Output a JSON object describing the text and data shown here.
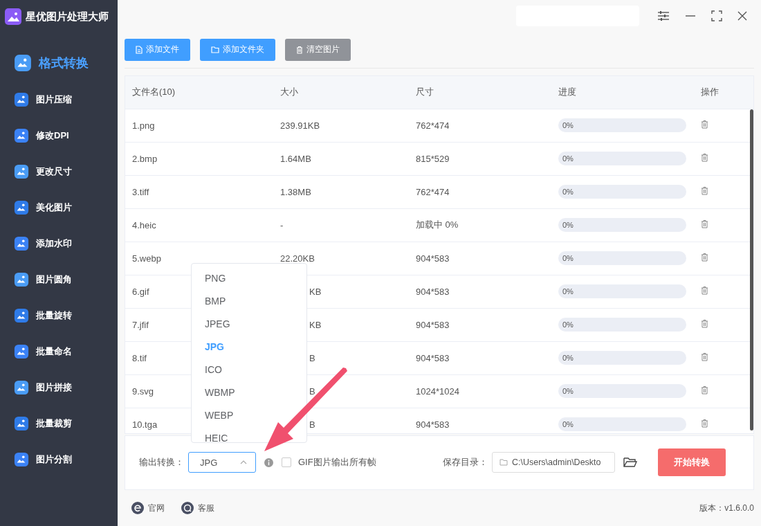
{
  "app": {
    "title": "星优图片处理大师"
  },
  "sidebar": {
    "items": [
      {
        "label": "格式转换",
        "selected": true
      },
      {
        "label": "图片压缩",
        "selected": false
      },
      {
        "label": "修改DPI",
        "selected": false
      },
      {
        "label": "更改尺寸",
        "selected": false
      },
      {
        "label": "美化图片",
        "selected": false
      },
      {
        "label": "添加水印",
        "selected": false
      },
      {
        "label": "图片圆角",
        "selected": false
      },
      {
        "label": "批量旋转",
        "selected": false
      },
      {
        "label": "批量命名",
        "selected": false
      },
      {
        "label": "图片拼接",
        "selected": false
      },
      {
        "label": "批量裁剪",
        "selected": false
      },
      {
        "label": "图片分割",
        "selected": false
      }
    ]
  },
  "toolbar": [
    {
      "label": "添加文件",
      "kind": "file"
    },
    {
      "label": "添加文件夹",
      "kind": "folder"
    },
    {
      "label": "清空图片",
      "kind": "clear"
    }
  ],
  "table": {
    "columns": [
      "文件名(10)",
      "大小",
      "尺寸",
      "进度",
      "操作"
    ],
    "rows": [
      {
        "name": "1.png",
        "size": "239.91KB",
        "dims": "762*474",
        "progress": "0%",
        "level": 0,
        "clipped": false
      },
      {
        "name": "2.bmp",
        "size": "1.64MB",
        "dims": "815*529",
        "progress": "0%",
        "level": 0,
        "clipped": false
      },
      {
        "name": "3.tiff",
        "size": "1.38MB",
        "dims": "762*474",
        "progress": "0%",
        "level": 0,
        "clipped": false
      },
      {
        "name": "4.heic",
        "size": "-",
        "dims": "加载中 0%",
        "progress": "0%",
        "level": 0,
        "clipped": false
      },
      {
        "name": "5.webp",
        "size": "22.20KB",
        "dims": "904*583",
        "progress": "0%",
        "level": 0,
        "clipped": false
      },
      {
        "name": "6.gif",
        "size": "KB",
        "dims": "904*583",
        "progress": "0%",
        "level": 0,
        "clipped": true
      },
      {
        "name": "7.jfif",
        "size": "KB",
        "dims": "904*583",
        "progress": "0%",
        "level": 0,
        "clipped": true
      },
      {
        "name": "8.tif",
        "size": "B",
        "dims": "904*583",
        "progress": "0%",
        "level": 0,
        "clipped": true
      },
      {
        "name": "9.svg",
        "size": "B",
        "dims": "1024*1024",
        "progress": "0%",
        "level": 0,
        "clipped": true
      },
      {
        "name": "10.tga",
        "size": "B",
        "dims": "904*583",
        "progress": "0%",
        "level": 0,
        "clipped": true
      }
    ]
  },
  "dropdown": {
    "options": [
      {
        "label": "PNG",
        "selected": false
      },
      {
        "label": "BMP",
        "selected": false
      },
      {
        "label": "JPEG",
        "selected": false
      },
      {
        "label": "JPG",
        "selected": true
      },
      {
        "label": "ICO",
        "selected": false
      },
      {
        "label": "WBMP",
        "selected": false
      },
      {
        "label": "WEBP",
        "selected": false
      },
      {
        "label": "HEIC",
        "selected": false
      }
    ]
  },
  "output": {
    "label": "输出转换：",
    "value": "JPG",
    "gif_label": "GIF图片输出所有帧",
    "gif_checked": false,
    "save_label": "保存目录：",
    "save_path": "C:\\Users\\admin\\Deskto",
    "start": "开始转换"
  },
  "footer": {
    "links": [
      "官网",
      "客服"
    ],
    "version": "版本：v1.6.0.0"
  }
}
